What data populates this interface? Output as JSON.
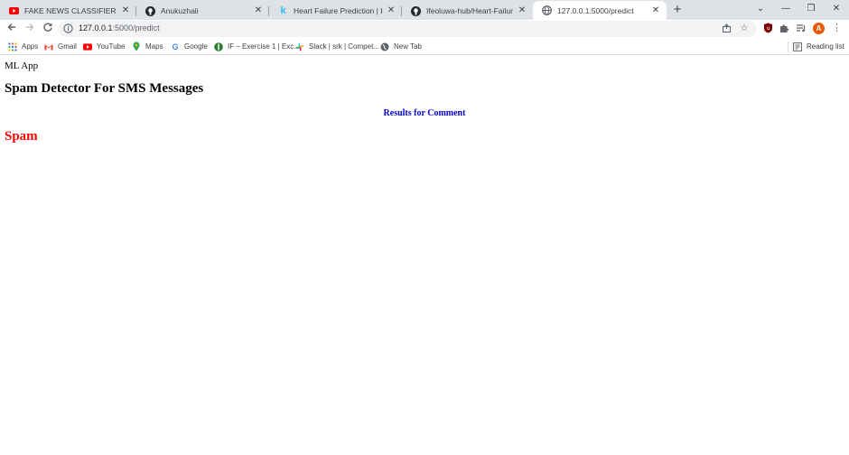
{
  "browser": {
    "tabs": [
      {
        "title": "FAKE NEWS CLASSIFIER WITH M",
        "icon": "youtube-icon",
        "active": false
      },
      {
        "title": "Anukuzhali",
        "icon": "github-icon",
        "active": false
      },
      {
        "title": "Heart Failure Prediction | Kaggle",
        "icon": "kaggle-icon",
        "active": false
      },
      {
        "title": "Ifeoluwa-hub/Heart-Failure-Predi",
        "icon": "github-icon",
        "active": false
      },
      {
        "title": "127.0.0.1:5000/predict",
        "icon": "globe-icon",
        "active": true
      }
    ],
    "new_tab_glyph": "+",
    "window_controls": {
      "dropdown": "⌄",
      "minimize": "—",
      "restore": "❐",
      "close": "✕"
    },
    "address": {
      "host": "127.0.0.1",
      "path": ":5000/predict"
    },
    "profile_initial": "A",
    "bookmarks": [
      {
        "label": "Apps",
        "icon": "apps-grid-icon"
      },
      {
        "label": "Gmail",
        "icon": "gmail-icon"
      },
      {
        "label": "YouTube",
        "icon": "youtube-icon"
      },
      {
        "label": "Maps",
        "icon": "maps-pin-icon"
      },
      {
        "label": "Google",
        "icon": "google-icon"
      },
      {
        "label": "IF – Exercise 1 | Exc...",
        "icon": "exercise-icon"
      },
      {
        "label": "Slack | srk | Compet...",
        "icon": "slack-icon"
      },
      {
        "label": "New Tab",
        "icon": "globe-icon"
      }
    ],
    "reading_list": {
      "label": "Reading list",
      "icon": "reading-list-icon"
    }
  },
  "page": {
    "brand": "ML App",
    "heading": "Spam Detector For SMS Messages",
    "results_label": "Results for Comment",
    "prediction": "Spam"
  },
  "colors": {
    "results": "#0000cc",
    "prediction": "#ff0000",
    "youtube": "#ff0000",
    "kaggle": "#20beff",
    "avatar": "#e8590c"
  }
}
